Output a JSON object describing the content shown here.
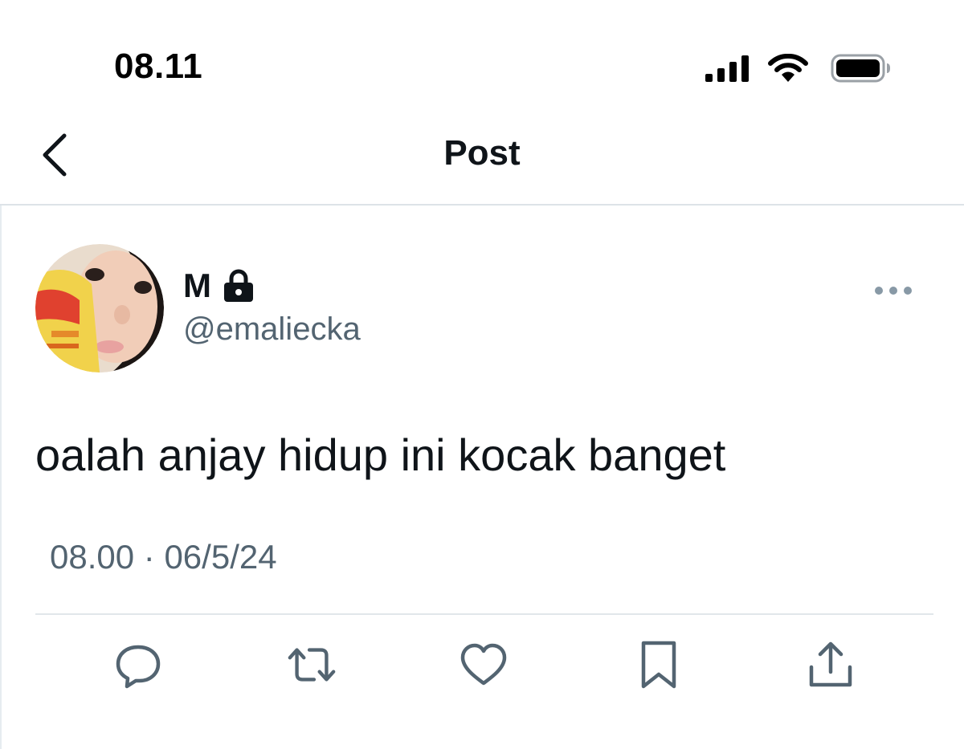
{
  "status_bar": {
    "time": "08.11",
    "icons": [
      "cellular-signal-icon",
      "wifi-icon",
      "battery-icon"
    ]
  },
  "header": {
    "title": "Post",
    "back_icon": "chevron-left-icon"
  },
  "tweet": {
    "author": {
      "display_name": "M",
      "protected": true,
      "handle": "@emaliecka"
    },
    "text": "oalah anjay hidup ini kocak banget",
    "time": "08.00",
    "separator": "·",
    "date": "06/5/24",
    "actions": [
      "reply-icon",
      "repost-icon",
      "like-icon",
      "bookmark-icon",
      "share-icon"
    ]
  },
  "colors": {
    "text_primary": "#0f1419",
    "text_secondary": "#536471",
    "icon_gray": "#536471",
    "divider": "#dde3e8"
  }
}
